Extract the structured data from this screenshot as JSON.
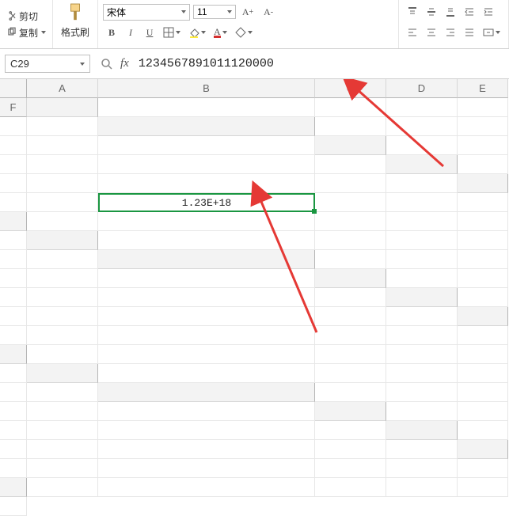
{
  "ribbon": {
    "cut": "剪切",
    "copy": "复制",
    "format_painter": "格式刷",
    "font_name": "宋体",
    "font_size": "11"
  },
  "name_box": "C29",
  "formula_bar": "1234567891011120000",
  "columns": [
    "A",
    "B",
    "C",
    "D",
    "E",
    "F"
  ],
  "active_cell_display": "1.23E+18"
}
